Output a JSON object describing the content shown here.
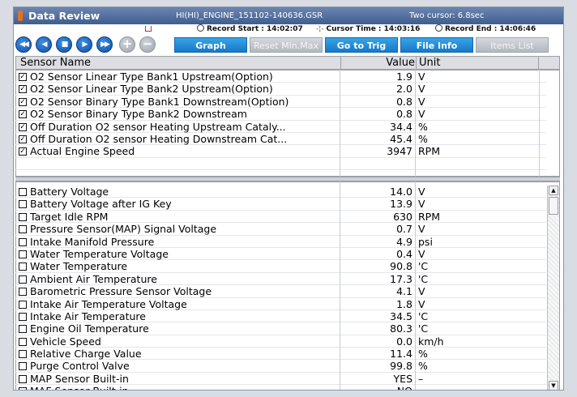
{
  "window": {
    "title": "Data Review",
    "file_name": "HI(HI)_ENGINE_151102-140636.GSR",
    "cursor_mode": "Two cursor: 6.8sec"
  },
  "info": {
    "record_start_label": "Record Start : 14:02:07",
    "cursor_time_label": "Cursor Time : 14:03:16",
    "record_end_label": "Record End :  14:06:46"
  },
  "toolbar": {
    "nav": [
      {
        "name": "rewind-fast-button",
        "glyph": "◀◀"
      },
      {
        "name": "step-back-button",
        "glyph": "◀"
      },
      {
        "name": "stop-button",
        "glyph": "■"
      },
      {
        "name": "play-button",
        "glyph": "▶"
      },
      {
        "name": "fast-forward-button",
        "glyph": "▶▶"
      },
      {
        "name": "zoom-in-button",
        "glyph": "+"
      },
      {
        "name": "zoom-out-button",
        "glyph": "−"
      }
    ],
    "graph_label": "Graph",
    "reset_label": "Reset Min.Max",
    "goto_label": "Go to Trig",
    "fileinfo_label": "File Info",
    "items_label": "Items List"
  },
  "table": {
    "col_name": "Sensor Name",
    "col_value": "Value",
    "col_unit": "Unit",
    "selected_rows": [
      {
        "name": "O2 Sensor Linear Type Bank1 Upstream(Option)",
        "value": "1.9",
        "unit": "V"
      },
      {
        "name": "O2 Sensor Linear Type Bank2 Upstream(Option)",
        "value": "2.0",
        "unit": "V"
      },
      {
        "name": "O2 Sensor Binary Type Bank1 Downstream(Option)",
        "value": "0.8",
        "unit": "V"
      },
      {
        "name": "O2 Sensor Binary Type Bank2 Downstream",
        "value": "0.8",
        "unit": "V"
      },
      {
        "name": "Off Duration O2 sensor Heating Upstream Cataly...",
        "value": "34.4",
        "unit": "%"
      },
      {
        "name": "Off Duration O2 sensor Heating Downstream Cat...",
        "value": "45.4",
        "unit": "%"
      },
      {
        "name": "Actual Engine Speed",
        "value": "3947",
        "unit": "RPM"
      }
    ],
    "other_rows": [
      {
        "name": "Battery Voltage",
        "value": "14.0",
        "unit": "V"
      },
      {
        "name": "Battery Voltage after IG Key",
        "value": "13.9",
        "unit": "V"
      },
      {
        "name": "Target Idle RPM",
        "value": "630",
        "unit": "RPM"
      },
      {
        "name": "Pressure Sensor(MAP) Signal Voltage",
        "value": "0.7",
        "unit": "V"
      },
      {
        "name": "Intake Manifold Pressure",
        "value": "4.9",
        "unit": "psi"
      },
      {
        "name": "Water Temperature Voltage",
        "value": "0.4",
        "unit": "V"
      },
      {
        "name": "Water Temperature",
        "value": "90.8",
        "unit": "'C"
      },
      {
        "name": "Ambient Air Temperature",
        "value": "17.3",
        "unit": "'C"
      },
      {
        "name": "Barometric Pressure Sensor Voltage",
        "value": "4.1",
        "unit": "V"
      },
      {
        "name": "Intake Air Temperature Voltage",
        "value": "1.8",
        "unit": "V"
      },
      {
        "name": "Intake Air Temperature",
        "value": "34.5",
        "unit": "'C"
      },
      {
        "name": "Engine Oil Temperature",
        "value": "80.3",
        "unit": "'C"
      },
      {
        "name": "Vehicle Speed",
        "value": "0.0",
        "unit": "km/h"
      },
      {
        "name": "Relative Charge Value",
        "value": "11.4",
        "unit": "%"
      },
      {
        "name": "Purge Control Valve",
        "value": "99.8",
        "unit": "%"
      },
      {
        "name": "MAP Sensor Built-in",
        "value": "YES",
        "unit": "–"
      },
      {
        "name": "MAF Sensor Built-in",
        "value": "NO",
        "unit": "–"
      }
    ]
  },
  "colors": {
    "accent_blue": "#1679c8",
    "title_bar": "#3f5d8e",
    "app_icon": "#e8701c"
  }
}
